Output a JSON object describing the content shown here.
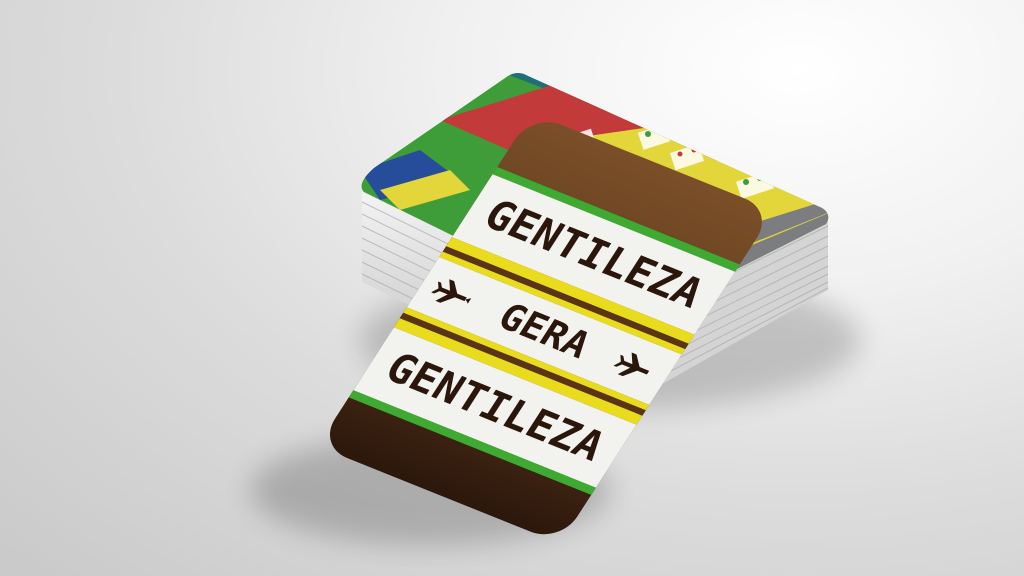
{
  "card": {
    "line_top": "GENTILEZA",
    "line_middle": "GERA",
    "line_bottom": "GENTILEZA"
  },
  "colors": {
    "card_brown": "#6b4423",
    "card_brown_dark": "#2c170c",
    "band_white": "#f2f2ee",
    "stripe_green": "#3eaa32",
    "stripe_yellow": "#e8dc1c",
    "stripe_brown": "#5a3414",
    "back_teal": "#1f6e78",
    "back_red": "#c23a3a",
    "back_yellow": "#e3d63a",
    "back_gray": "#7b7d80",
    "back_green": "#3e9d38",
    "back_blue": "#254d99"
  },
  "icons": [
    "airplane-icon",
    "airplane-icon"
  ]
}
